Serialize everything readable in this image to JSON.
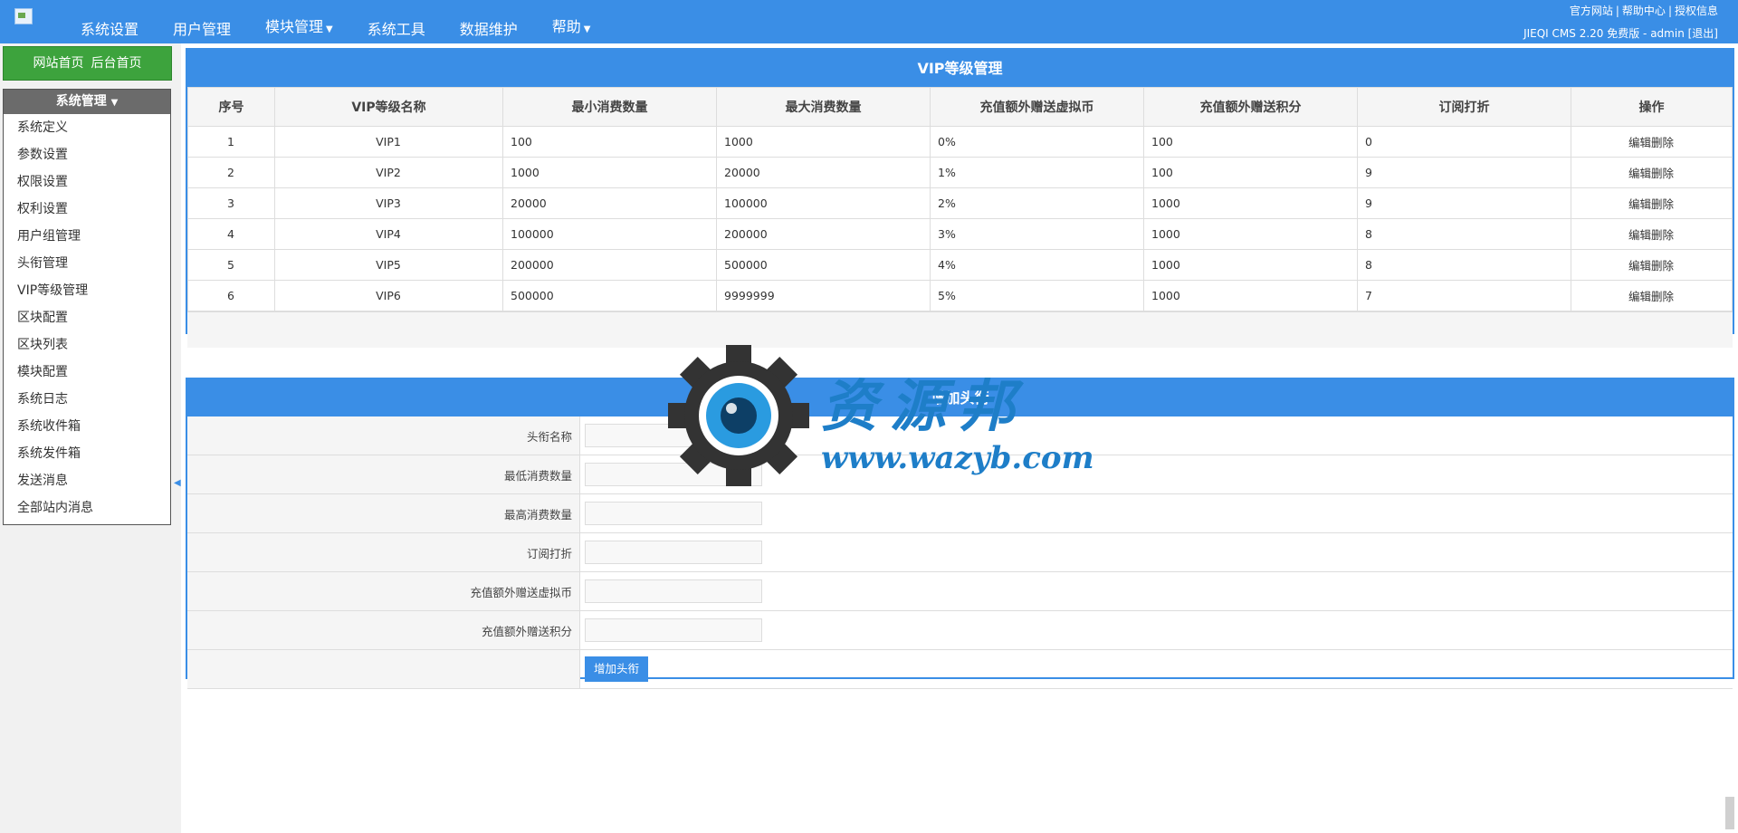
{
  "header": {
    "nav": [
      {
        "label": "系统设置",
        "caret": false
      },
      {
        "label": "用户管理",
        "caret": false
      },
      {
        "label": "模块管理",
        "caret": true
      },
      {
        "label": "系统工具",
        "caret": false
      },
      {
        "label": "数据维护",
        "caret": false
      },
      {
        "label": "帮助",
        "caret": true
      }
    ],
    "links": [
      "官方网站",
      "帮助中心",
      "授权信息"
    ],
    "site_info": "JIEQI CMS 2.20 免费版 - admin",
    "logout": "[退出]"
  },
  "sidebar": {
    "home_links": [
      "网站首页",
      "后台首页"
    ],
    "menu_title": "系统管理",
    "items": [
      "系统定义",
      "参数设置",
      "权限设置",
      "权利设置",
      "用户组管理",
      "头衔管理",
      "VIP等级管理",
      "区块配置",
      "区块列表",
      "模块配置",
      "系统日志",
      "系统收件箱",
      "系统发件箱",
      "发送消息",
      "全部站内消息"
    ]
  },
  "vip_table": {
    "title": "VIP等级管理",
    "columns": [
      "序号",
      "VIP等级名称",
      "最小消费数量",
      "最大消费数量",
      "充值额外赠送虚拟币",
      "充值额外赠送积分",
      "订阅打折",
      "操作"
    ],
    "op_edit": "编辑",
    "op_delete": "删除",
    "rows": [
      {
        "no": "1",
        "name": "VIP1",
        "min": "100",
        "max": "1000",
        "coin": "0%",
        "points": "100",
        "discount": "0"
      },
      {
        "no": "2",
        "name": "VIP2",
        "min": "1000",
        "max": "20000",
        "coin": "1%",
        "points": "100",
        "discount": "9"
      },
      {
        "no": "3",
        "name": "VIP3",
        "min": "20000",
        "max": "100000",
        "coin": "2%",
        "points": "1000",
        "discount": "9"
      },
      {
        "no": "4",
        "name": "VIP4",
        "min": "100000",
        "max": "200000",
        "coin": "3%",
        "points": "1000",
        "discount": "8"
      },
      {
        "no": "5",
        "name": "VIP5",
        "min": "200000",
        "max": "500000",
        "coin": "4%",
        "points": "1000",
        "discount": "8"
      },
      {
        "no": "6",
        "name": "VIP6",
        "min": "500000",
        "max": "9999999",
        "coin": "5%",
        "points": "1000",
        "discount": "7"
      }
    ]
  },
  "add_form": {
    "title": "增加头衔",
    "fields": [
      {
        "label": "头衔名称",
        "value": ""
      },
      {
        "label": "最低消费数量",
        "value": ""
      },
      {
        "label": "最高消费数量",
        "value": ""
      },
      {
        "label": "订阅打折",
        "value": ""
      },
      {
        "label": "充值额外赠送虚拟币",
        "value": ""
      },
      {
        "label": "充值额外赠送积分",
        "value": ""
      }
    ],
    "submit_label": "增加头衔"
  },
  "watermark": {
    "title": "资源邦",
    "url": "www.wazyb.com",
    "color": "#1e7ec8"
  },
  "colors": {
    "brand_blue": "#3a8ee6",
    "home_green": "#3da33d",
    "menu_title_gray": "#6b6b6b"
  }
}
